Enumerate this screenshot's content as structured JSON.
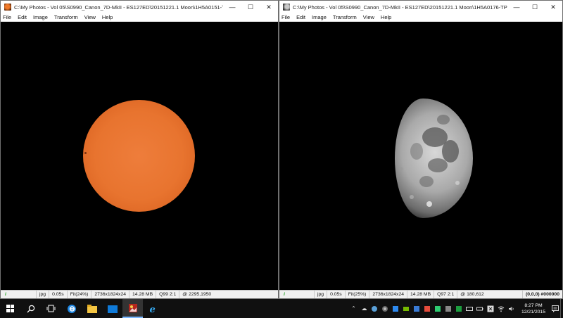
{
  "windows": [
    {
      "title": "C:\\My Photos - Vol 05\\S0990_Canon_7D-MkII - ES127ED\\20151221.1 Moon\\1H5A0151-TPadj.J...",
      "menu": [
        "File",
        "Edit",
        "Image",
        "Transform",
        "View",
        "Help"
      ],
      "status": {
        "format": "jpg",
        "time": "0.05s",
        "fit": "Fit(24%)",
        "dimensions": "2736x1824x24",
        "size": "14.28 MB",
        "quality": "Q99 2:1",
        "coords": "@ 2295,1950",
        "pixel": ""
      }
    },
    {
      "title": "C:\\My Photos - Vol 05\\S0990_Canon_7D-MkII - ES127ED\\20151221.1 Moon\\1H5A0176-TPadj2.JPG",
      "menu": [
        "File",
        "Edit",
        "Image",
        "Transform",
        "View",
        "Help"
      ],
      "status": {
        "format": "jpg",
        "time": "0.05s",
        "fit": "Fit(25%)",
        "dimensions": "2736x1824x24",
        "size": "14.28 MB",
        "quality": "Q97 2:1",
        "coords": "@ 180,612",
        "pixel": "(0,0,0) #000000"
      }
    }
  ],
  "window_controls": {
    "minimize": "—",
    "maximize": "☐",
    "close": "✕"
  },
  "status_indicator": "i",
  "taskbar": {
    "clock_time": "8:27 PM",
    "clock_date": "12/21/2015"
  },
  "colors": {
    "sun": "#e8742f",
    "taskbar": "#101010",
    "accent": "#7ab7ff"
  }
}
